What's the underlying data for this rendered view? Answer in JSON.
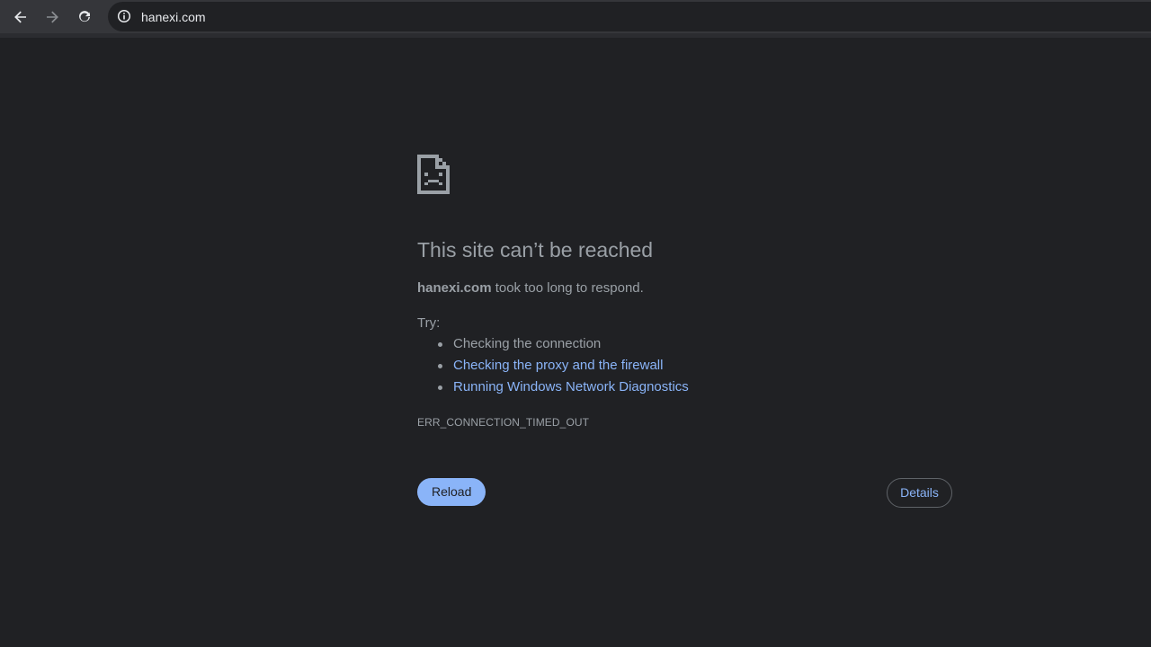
{
  "browser": {
    "url": "hanexi.com",
    "icons": {
      "back": "back-arrow-icon",
      "forward": "forward-arrow-icon",
      "reload": "reload-icon",
      "site_info": "info-icon"
    }
  },
  "error_page": {
    "icon": "sad-page-icon",
    "title": "This site can’t be reached",
    "summary": {
      "host": "hanexi.com",
      "message": " took too long to respond."
    },
    "try_label": "Try:",
    "suggestions": [
      {
        "text": "Checking the connection",
        "link": false
      },
      {
        "text": "Checking the proxy and the firewall",
        "link": true
      },
      {
        "text": "Running Windows Network Diagnostics",
        "link": true
      }
    ],
    "error_code": "ERR_CONNECTION_TIMED_OUT",
    "reload_label": "Reload",
    "details_label": "Details"
  },
  "colors": {
    "background": "#202124",
    "toolbar": "#35363a",
    "text": "#9aa0a6",
    "link": "#8ab4f8",
    "primary_button": "#8ab4f8"
  }
}
